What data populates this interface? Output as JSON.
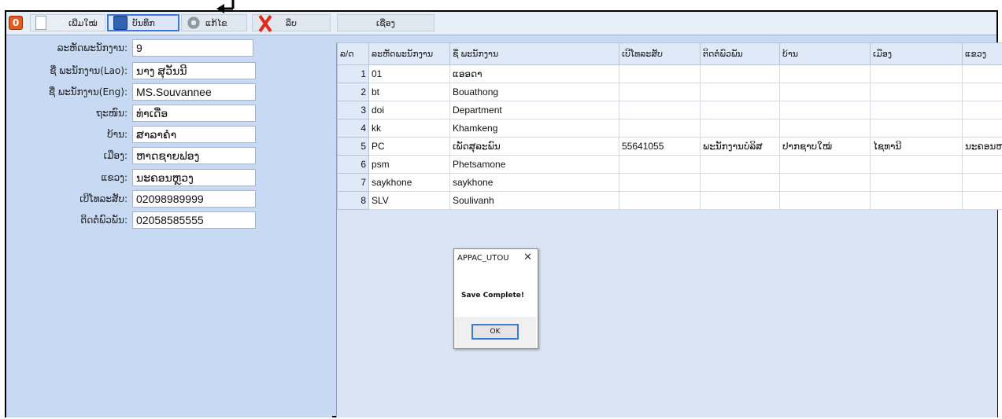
{
  "toolbar": {
    "power_glyph": "0",
    "new_label": "ເພີ່ມໃໝ່",
    "save_label": "ບັນທຶກ",
    "edit_label": "ແກ້ໄຂ",
    "delete_label": "ລຶບ",
    "search_label": "ເຊື່ອງ"
  },
  "form": {
    "fields": [
      {
        "label": "ລະຫັດພະນັກງານ:",
        "value": "9"
      },
      {
        "label": "ຊື່ ພະນັກງານ(Lao):",
        "value": "ນາງ ສຸວັນນີ"
      },
      {
        "label": "ຊື່ ພະນັກງານ(Eng):",
        "value": "MS.Souvannee"
      },
      {
        "label": "ຖະໜົນ:",
        "value": "ທ່າເດື່ອ"
      },
      {
        "label": "ບ້ານ:",
        "value": "ສາລາຄຳ"
      },
      {
        "label": "ເມືອງ:",
        "value": "ຫາດຊາຍຟອງ"
      },
      {
        "label": "ແຂວງ:",
        "value": "ນະຄອນຫຼວງ"
      },
      {
        "label": "ເບີໂທລະສັບ:",
        "value": "02098989999"
      },
      {
        "label": "ຕິດຕໍ່ພົວພັນ:",
        "value": "02058585555"
      }
    ]
  },
  "grid": {
    "columns": [
      "ລ/ດ",
      "ລະຫັດພະນັກງານ",
      "ຊື່ ພະນັກງານ",
      "ເບີໂທລະສັບ",
      "ຕິດຕໍ່ພົວພັນ",
      "ບ້ານ",
      "ເມືອງ",
      "ແຂວງ"
    ],
    "rows": [
      [
        "1",
        "01",
        "ແອອດາ",
        "",
        "",
        "",
        "",
        ""
      ],
      [
        "2",
        "bt",
        "Bouathong",
        "",
        "",
        "",
        "",
        ""
      ],
      [
        "3",
        "doi",
        "Department",
        "",
        "",
        "",
        "",
        ""
      ],
      [
        "4",
        "kk",
        "Khamkeng",
        "",
        "",
        "",
        "",
        ""
      ],
      [
        "5",
        "PC",
        "ເພັດສຸລະພົນ",
        "55641055",
        "ພະນັກງານບໍລິສ",
        "ປາກຊາບໃໝ່",
        "ໄຊທານີ",
        "ນະຄອນຫລວງ"
      ],
      [
        "6",
        "psm",
        "Phetsamone",
        "",
        "",
        "",
        "",
        ""
      ],
      [
        "7",
        "saykhone",
        "saykhone",
        "",
        "",
        "",
        "",
        ""
      ],
      [
        "8",
        "SLV",
        "Soulivanh",
        "",
        "",
        "",
        "",
        ""
      ]
    ]
  },
  "dialog": {
    "title": "APPAC_UTOU",
    "close": "✕",
    "message": "Save Complete!",
    "ok_label": "OK"
  },
  "colors": {
    "panel_bg": "#c7d9f3",
    "accent_border": "#3d78d8",
    "delete_red": "#e02a1a",
    "power_orange": "#e55a1e"
  },
  "icons": [
    "power-icon",
    "new-document-icon",
    "save-disk-icon",
    "edit-gear-icon",
    "delete-x-icon",
    "arrow-pointer-icon"
  ]
}
